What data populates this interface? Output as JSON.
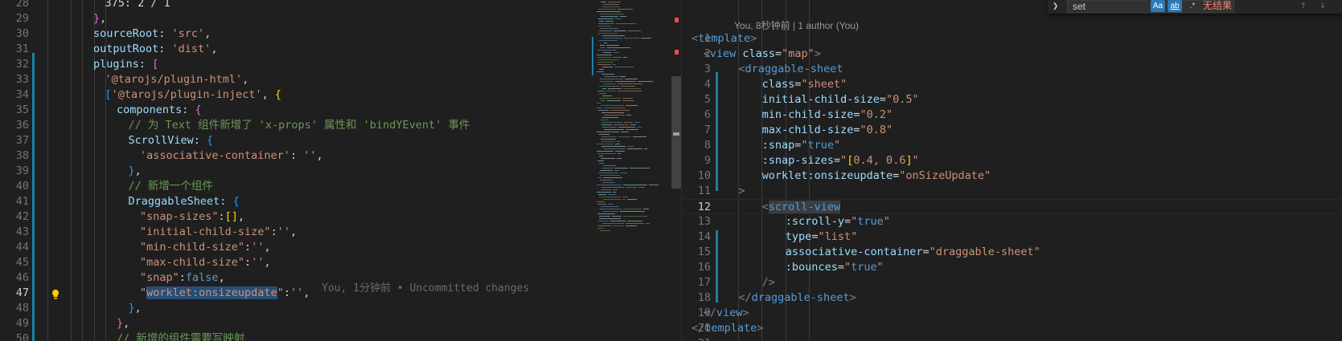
{
  "left_editor": {
    "lines": [
      {
        "num": "28",
        "tokens": [
          {
            "t": "375: 2 / 1",
            "c": "pun"
          }
        ],
        "indent": 6
      },
      {
        "num": "29",
        "tokens": [
          {
            "t": "}",
            "c": "br2"
          },
          {
            "t": ",",
            "c": "pun"
          }
        ],
        "indent": 4
      },
      {
        "num": "30",
        "tokens": [
          {
            "t": "sourceRoot",
            "c": "prop"
          },
          {
            "t": ": ",
            "c": "pun"
          },
          {
            "t": "'src'",
            "c": "str"
          },
          {
            "t": ",",
            "c": "pun"
          }
        ],
        "indent": 4
      },
      {
        "num": "31",
        "tokens": [
          {
            "t": "outputRoot",
            "c": "prop"
          },
          {
            "t": ": ",
            "c": "pun"
          },
          {
            "t": "'dist'",
            "c": "str"
          },
          {
            "t": ",",
            "c": "pun"
          }
        ],
        "indent": 4
      },
      {
        "num": "32",
        "tokens": [
          {
            "t": "plugins",
            "c": "prop"
          },
          {
            "t": ": ",
            "c": "pun"
          },
          {
            "t": "[",
            "c": "br2"
          }
        ],
        "indent": 4
      },
      {
        "num": "33",
        "tokens": [
          {
            "t": "'@tarojs/plugin-html'",
            "c": "str"
          },
          {
            "t": ",",
            "c": "pun"
          }
        ],
        "indent": 6
      },
      {
        "num": "34",
        "tokens": [
          {
            "t": "[",
            "c": "br3"
          },
          {
            "t": "'@tarojs/plugin-inject'",
            "c": "str"
          },
          {
            "t": ", ",
            "c": "pun"
          },
          {
            "t": "{",
            "c": "br1"
          }
        ],
        "indent": 6
      },
      {
        "num": "35",
        "tokens": [
          {
            "t": "components",
            "c": "prop"
          },
          {
            "t": ": ",
            "c": "pun"
          },
          {
            "t": "{",
            "c": "br2"
          }
        ],
        "indent": 8
      },
      {
        "num": "36",
        "tokens": [
          {
            "t": "// 为 Text 组件新增了 'x-props' 属性和 'bindYEvent' 事件",
            "c": "com"
          }
        ],
        "indent": 10
      },
      {
        "num": "37",
        "tokens": [
          {
            "t": "ScrollView",
            "c": "prop"
          },
          {
            "t": ": ",
            "c": "pun"
          },
          {
            "t": "{",
            "c": "br3"
          }
        ],
        "indent": 10
      },
      {
        "num": "38",
        "tokens": [
          {
            "t": "'associative-container'",
            "c": "str"
          },
          {
            "t": ": ",
            "c": "pun"
          },
          {
            "t": "''",
            "c": "str"
          },
          {
            "t": ",",
            "c": "pun"
          }
        ],
        "indent": 12
      },
      {
        "num": "39",
        "tokens": [
          {
            "t": "}",
            "c": "br3"
          },
          {
            "t": ",",
            "c": "pun"
          }
        ],
        "indent": 10
      },
      {
        "num": "40",
        "tokens": [
          {
            "t": "// 新增一个组件",
            "c": "com"
          }
        ],
        "indent": 10
      },
      {
        "num": "41",
        "tokens": [
          {
            "t": "DraggableSheet",
            "c": "prop"
          },
          {
            "t": ": ",
            "c": "pun"
          },
          {
            "t": "{",
            "c": "br3"
          }
        ],
        "indent": 10
      },
      {
        "num": "42",
        "tokens": [
          {
            "t": "\"snap-sizes\"",
            "c": "str"
          },
          {
            "t": ":",
            "c": "pun"
          },
          {
            "t": "[]",
            "c": "br1"
          },
          {
            "t": ",",
            "c": "pun"
          }
        ],
        "indent": 12
      },
      {
        "num": "43",
        "tokens": [
          {
            "t": "\"initial-child-size\"",
            "c": "str"
          },
          {
            "t": ":",
            "c": "pun"
          },
          {
            "t": "''",
            "c": "str"
          },
          {
            "t": ",",
            "c": "pun"
          }
        ],
        "indent": 12
      },
      {
        "num": "44",
        "tokens": [
          {
            "t": "\"min-child-size\"",
            "c": "str"
          },
          {
            "t": ":",
            "c": "pun"
          },
          {
            "t": "''",
            "c": "str"
          },
          {
            "t": ",",
            "c": "pun"
          }
        ],
        "indent": 12
      },
      {
        "num": "45",
        "tokens": [
          {
            "t": "\"max-child-size\"",
            "c": "str"
          },
          {
            "t": ":",
            "c": "pun"
          },
          {
            "t": "''",
            "c": "str"
          },
          {
            "t": ",",
            "c": "pun"
          }
        ],
        "indent": 12
      },
      {
        "num": "46",
        "tokens": [
          {
            "t": "\"snap\"",
            "c": "str"
          },
          {
            "t": ":",
            "c": "pun"
          },
          {
            "t": "false",
            "c": "kw"
          },
          {
            "t": ",",
            "c": "pun"
          }
        ],
        "indent": 12
      },
      {
        "num": "47",
        "tokens": [
          {
            "t": "\"",
            "c": "str"
          },
          {
            "t": "worklet:onsizeupdate",
            "c": "str hl"
          },
          {
            "t": "\"",
            "c": "str"
          },
          {
            "t": ":",
            "c": "pun"
          },
          {
            "t": "''",
            "c": "str"
          },
          {
            "t": ",",
            "c": "pun"
          }
        ],
        "indent": 12,
        "current": true
      },
      {
        "num": "48",
        "tokens": [
          {
            "t": "}",
            "c": "br3"
          },
          {
            "t": ",",
            "c": "pun"
          }
        ],
        "indent": 10
      },
      {
        "num": "49",
        "tokens": [
          {
            "t": "}",
            "c": "br2"
          },
          {
            "t": ",",
            "c": "pun"
          }
        ],
        "indent": 8
      },
      {
        "num": "50",
        "tokens": [
          {
            "t": "// 新增的组件需要写映射",
            "c": "com"
          }
        ],
        "indent": 8
      }
    ],
    "blame_text": "You, 1分钟前 • Uncommitted changes"
  },
  "right_editor": {
    "codelens": "You, 8秒钟前 | 1 author (You)",
    "lines": [
      {
        "num": "1",
        "tokens": [
          {
            "t": "<",
            "c": "tagp"
          },
          {
            "t": "template",
            "c": "kw"
          },
          {
            "t": ">",
            "c": "tagp"
          }
        ],
        "indent": 0
      },
      {
        "num": "2",
        "tokens": [
          {
            "t": "<",
            "c": "tagp"
          },
          {
            "t": "view",
            "c": "kw"
          },
          {
            "t": " ",
            "c": "pun"
          },
          {
            "t": "class",
            "c": "prop"
          },
          {
            "t": "=",
            "c": "pun"
          },
          {
            "t": "\"map\"",
            "c": "str"
          },
          {
            "t": ">",
            "c": "tagp"
          }
        ],
        "indent": 2
      },
      {
        "num": "3",
        "tokens": [
          {
            "t": "<",
            "c": "tagp"
          },
          {
            "t": "draggable-sheet",
            "c": "kw"
          }
        ],
        "indent": 8
      },
      {
        "num": "4",
        "tokens": [
          {
            "t": "class",
            "c": "prop"
          },
          {
            "t": "=",
            "c": "pun"
          },
          {
            "t": "\"sheet\"",
            "c": "str"
          }
        ],
        "indent": 12
      },
      {
        "num": "5",
        "tokens": [
          {
            "t": "initial-child-size",
            "c": "prop"
          },
          {
            "t": "=",
            "c": "pun"
          },
          {
            "t": "\"0.5\"",
            "c": "str"
          }
        ],
        "indent": 12
      },
      {
        "num": "6",
        "tokens": [
          {
            "t": "min-child-size",
            "c": "prop"
          },
          {
            "t": "=",
            "c": "pun"
          },
          {
            "t": "\"0.2\"",
            "c": "str"
          }
        ],
        "indent": 12
      },
      {
        "num": "7",
        "tokens": [
          {
            "t": "max-child-size",
            "c": "prop"
          },
          {
            "t": "=",
            "c": "pun"
          },
          {
            "t": "\"0.8\"",
            "c": "str"
          }
        ],
        "indent": 12
      },
      {
        "num": "8",
        "tokens": [
          {
            "t": ":snap",
            "c": "prop"
          },
          {
            "t": "=",
            "c": "pun"
          },
          {
            "t": "\"",
            "c": "str"
          },
          {
            "t": "true",
            "c": "kw"
          },
          {
            "t": "\"",
            "c": "str"
          }
        ],
        "indent": 12
      },
      {
        "num": "9",
        "tokens": [
          {
            "t": ":snap-sizes",
            "c": "prop"
          },
          {
            "t": "=",
            "c": "pun"
          },
          {
            "t": "\"",
            "c": "str"
          },
          {
            "t": "[",
            "c": "br1"
          },
          {
            "t": "0.4, 0.6",
            "c": "str"
          },
          {
            "t": "]",
            "c": "br1"
          },
          {
            "t": "\"",
            "c": "str"
          }
        ],
        "indent": 12
      },
      {
        "num": "10",
        "tokens": [
          {
            "t": "worklet:onsizeupdate",
            "c": "prop"
          },
          {
            "t": "=",
            "c": "pun"
          },
          {
            "t": "\"onSizeUpdate\"",
            "c": "str"
          }
        ],
        "indent": 12
      },
      {
        "num": "11",
        "tokens": [
          {
            "t": ">",
            "c": "tagp"
          }
        ],
        "indent": 8
      },
      {
        "num": "12",
        "tokens": [
          {
            "t": "<",
            "c": "tagp"
          },
          {
            "t": "scroll-view",
            "c": "kw hl2"
          }
        ],
        "indent": 12,
        "current": true
      },
      {
        "num": "13",
        "tokens": [
          {
            "t": ":scroll-y",
            "c": "prop"
          },
          {
            "t": "=",
            "c": "pun"
          },
          {
            "t": "\"",
            "c": "str"
          },
          {
            "t": "true",
            "c": "kw"
          },
          {
            "t": "\"",
            "c": "str"
          }
        ],
        "indent": 16
      },
      {
        "num": "14",
        "tokens": [
          {
            "t": "type",
            "c": "prop"
          },
          {
            "t": "=",
            "c": "pun"
          },
          {
            "t": "\"list\"",
            "c": "str"
          }
        ],
        "indent": 16
      },
      {
        "num": "15",
        "tokens": [
          {
            "t": "associative-container",
            "c": "prop"
          },
          {
            "t": "=",
            "c": "pun"
          },
          {
            "t": "\"draggable-sheet\"",
            "c": "str"
          }
        ],
        "indent": 16
      },
      {
        "num": "16",
        "tokens": [
          {
            "t": ":bounces",
            "c": "prop"
          },
          {
            "t": "=",
            "c": "pun"
          },
          {
            "t": "\"",
            "c": "str"
          },
          {
            "t": "true",
            "c": "kw"
          },
          {
            "t": "\"",
            "c": "str"
          }
        ],
        "indent": 16
      },
      {
        "num": "17",
        "tokens": [
          {
            "t": "/>",
            "c": "tagp"
          }
        ],
        "indent": 12
      },
      {
        "num": "18",
        "tokens": [
          {
            "t": "</",
            "c": "tagp"
          },
          {
            "t": "draggable-sheet",
            "c": "kw"
          },
          {
            "t": ">",
            "c": "tagp"
          }
        ],
        "indent": 8
      },
      {
        "num": "19",
        "tokens": [
          {
            "t": "</",
            "c": "tagp"
          },
          {
            "t": "view",
            "c": "kw"
          },
          {
            "t": ">",
            "c": "tagp"
          }
        ],
        "indent": 2
      },
      {
        "num": "20",
        "tokens": [
          {
            "t": "</",
            "c": "tagp"
          },
          {
            "t": "template",
            "c": "kw"
          },
          {
            "t": ">",
            "c": "tagp"
          }
        ],
        "indent": 0
      },
      {
        "num": "21",
        "tokens": [],
        "indent": 0
      }
    ]
  },
  "find_widget": {
    "query": "set",
    "match_case": "Aa",
    "whole_word": "ab",
    "regex": ".*",
    "result": "无结果",
    "toggle_icon": "chevron-right-icon",
    "prev_icon": "arrow-up-icon",
    "next_icon": "arrow-down-icon"
  },
  "colors": {
    "background": "#1f1f1f",
    "keyword": "#569cd6",
    "property": "#9cdcfe",
    "string": "#ce9178",
    "comment": "#6a9955",
    "no_results": "#f48771",
    "modified_gutter": "#1b81a8"
  }
}
